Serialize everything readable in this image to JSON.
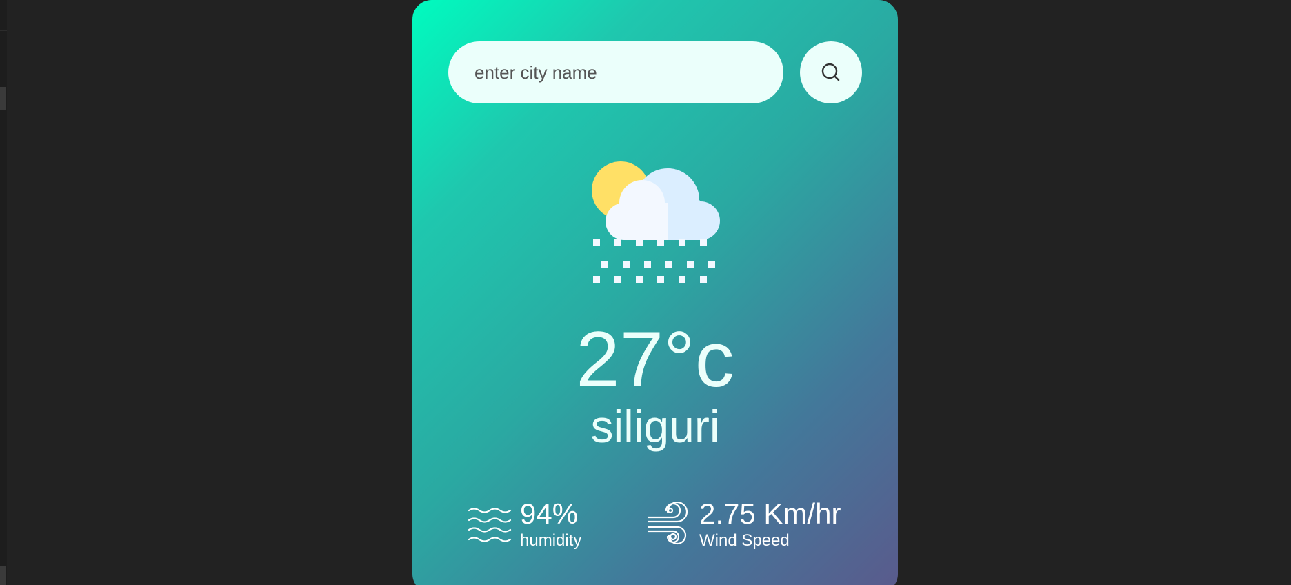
{
  "search": {
    "placeholder": "enter city name",
    "value": ""
  },
  "icons": {
    "search_button": "search-icon",
    "weather": "sun-cloud-snow-icon",
    "humidity": "humidity-waves-icon",
    "wind": "wind-icon"
  },
  "weather": {
    "temperature": "27°c",
    "city": "siliguri"
  },
  "details": {
    "humidity": {
      "value": "94%",
      "label": "humidity"
    },
    "wind": {
      "value": "2.75 Km/hr",
      "label": "Wind Speed"
    }
  },
  "colors": {
    "background": "#222222",
    "card_gradient_start": "#00fcbf",
    "card_gradient_end": "#5a5a8c",
    "input_background": "#ebfffb",
    "text_light": "#ebfffb"
  }
}
